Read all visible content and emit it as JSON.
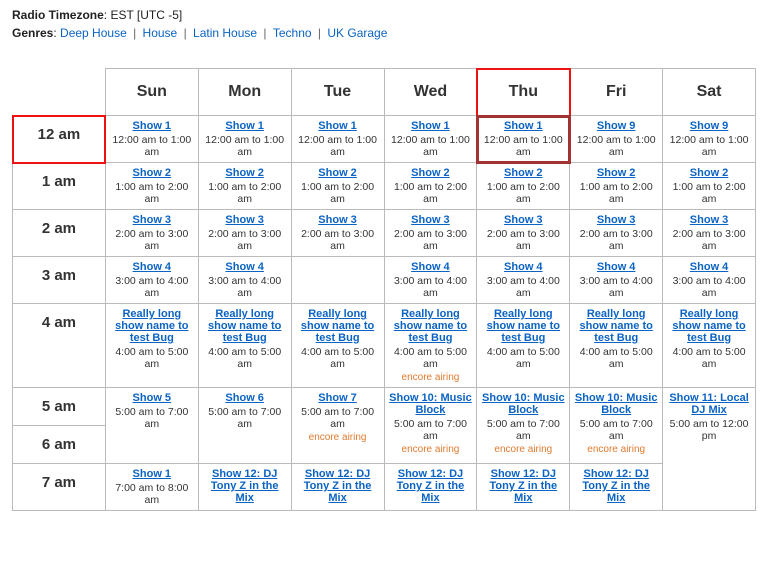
{
  "meta": {
    "tz_label": "Radio Timezone",
    "tz_value": "EST [UTC -5]",
    "genres_label": "Genres",
    "genres": [
      "Deep House",
      "House",
      "Latin House",
      "Techno",
      "UK Garage"
    ],
    "separator": "|"
  },
  "days": [
    "Sun",
    "Mon",
    "Tue",
    "Wed",
    "Thu",
    "Fri",
    "Sat"
  ],
  "hours": [
    "12 am",
    "1 am",
    "2 am",
    "3 am",
    "4 am",
    "5 am",
    "6 am",
    "7 am"
  ],
  "highlight": {
    "day_index": 4,
    "hour_index": 0
  },
  "grid": [
    [
      {
        "title": "Show 1",
        "time": "12:00 am to 1:00 am",
        "rowspan": 1
      },
      {
        "title": "Show 1",
        "time": "12:00 am to 1:00 am",
        "rowspan": 1
      },
      {
        "title": "Show 1",
        "time": "12:00 am to 1:00 am",
        "rowspan": 1
      },
      {
        "title": "Show 1",
        "time": "12:00 am to 1:00 am",
        "rowspan": 1
      },
      {
        "title": "Show 1",
        "time": "12:00 am to 1:00 am",
        "rowspan": 1
      },
      {
        "title": "Show 9",
        "time": "12:00 am to 1:00 am",
        "rowspan": 1
      },
      {
        "title": "Show 9",
        "time": "12:00 am to 1:00 am",
        "rowspan": 1
      }
    ],
    [
      {
        "title": "Show 2",
        "time": "1:00 am to 2:00 am",
        "rowspan": 1
      },
      {
        "title": "Show 2",
        "time": "1:00 am to 2:00 am",
        "rowspan": 1
      },
      {
        "title": "Show 2",
        "time": "1:00 am to 2:00 am",
        "rowspan": 1
      },
      {
        "title": "Show 2",
        "time": "1:00 am to 2:00 am",
        "rowspan": 1
      },
      {
        "title": "Show 2",
        "time": "1:00 am to 2:00 am",
        "rowspan": 1
      },
      {
        "title": "Show 2",
        "time": "1:00 am to 2:00 am",
        "rowspan": 1
      },
      {
        "title": "Show 2",
        "time": "1:00 am to 2:00 am",
        "rowspan": 1
      }
    ],
    [
      {
        "title": "Show 3",
        "time": "2:00 am to 3:00 am",
        "rowspan": 1
      },
      {
        "title": "Show 3",
        "time": "2:00 am to 3:00 am",
        "rowspan": 1
      },
      {
        "title": "Show 3",
        "time": "2:00 am to 3:00 am",
        "rowspan": 1
      },
      {
        "title": "Show 3",
        "time": "2:00 am to 3:00 am",
        "rowspan": 1
      },
      {
        "title": "Show 3",
        "time": "2:00 am to 3:00 am",
        "rowspan": 1
      },
      {
        "title": "Show 3",
        "time": "2:00 am to 3:00 am",
        "rowspan": 1
      },
      {
        "title": "Show 3",
        "time": "2:00 am to 3:00 am",
        "rowspan": 1
      }
    ],
    [
      {
        "title": "Show 4",
        "time": "3:00 am to 4:00 am",
        "rowspan": 1
      },
      {
        "title": "Show 4",
        "time": "3:00 am to 4:00 am",
        "rowspan": 1
      },
      null,
      {
        "title": "Show 4",
        "time": "3:00 am to 4:00 am",
        "rowspan": 1
      },
      {
        "title": "Show 4",
        "time": "3:00 am to 4:00 am",
        "rowspan": 1
      },
      {
        "title": "Show 4",
        "time": "3:00 am to 4:00 am",
        "rowspan": 1
      },
      {
        "title": "Show 4",
        "time": "3:00 am to 4:00 am",
        "rowspan": 1
      }
    ],
    [
      {
        "title": "Really long show name to test Bug",
        "time": "4:00 am to 5:00 am",
        "rowspan": 1
      },
      {
        "title": "Really long show name to test Bug",
        "time": "4:00 am to 5:00 am",
        "rowspan": 1
      },
      {
        "title": "Really long show name to test Bug",
        "time": "4:00 am to 5:00 am",
        "rowspan": 1
      },
      {
        "title": "Really long show name to test Bug",
        "time": "4:00 am to 5:00 am",
        "encore": "encore airing",
        "rowspan": 1
      },
      {
        "title": "Really long show name to test Bug",
        "time": "4:00 am to 5:00 am",
        "rowspan": 1
      },
      {
        "title": "Really long show name to test Bug",
        "time": "4:00 am to 5:00 am",
        "rowspan": 1
      },
      {
        "title": "Really long show name to test Bug",
        "time": "4:00 am to 5:00 am",
        "rowspan": 1
      }
    ],
    [
      {
        "title": "Show 5",
        "time": "5:00 am to 7:00 am",
        "rowspan": 2
      },
      {
        "title": "Show 6",
        "time": "5:00 am to 7:00 am",
        "rowspan": 2
      },
      {
        "title": "Show 7",
        "time": "5:00 am to 7:00 am",
        "encore": "encore airing",
        "rowspan": 2
      },
      {
        "title": "Show 10: Music Block",
        "time": "5:00 am to 7:00 am",
        "encore": "encore airing",
        "rowspan": 2
      },
      {
        "title": "Show 10: Music Block",
        "time": "5:00 am to 7:00 am",
        "encore": "encore airing",
        "rowspan": 2
      },
      {
        "title": "Show 10: Music Block",
        "time": "5:00 am to 7:00 am",
        "encore": "encore airing",
        "rowspan": 2
      },
      {
        "title": "Show 11: Local DJ Mix",
        "time": "5:00 am to 12:00 pm",
        "rowspan": 3
      }
    ],
    [
      "span",
      "span",
      "span",
      "span",
      "span",
      "span",
      "span"
    ],
    [
      {
        "title": "Show 1",
        "time": "7:00 am to 8:00 am",
        "rowspan": 1
      },
      {
        "title": "Show 12: DJ Tony Z in the Mix",
        "time": "",
        "rowspan": 1
      },
      {
        "title": "Show 12: DJ Tony Z in the Mix",
        "time": "",
        "rowspan": 1
      },
      {
        "title": "Show 12: DJ Tony Z in the Mix",
        "time": "",
        "rowspan": 1
      },
      {
        "title": "Show 12: DJ Tony Z in the Mix",
        "time": "",
        "rowspan": 1
      },
      {
        "title": "Show 12: DJ Tony Z in the Mix",
        "time": "",
        "rowspan": 1
      },
      "span"
    ]
  ]
}
